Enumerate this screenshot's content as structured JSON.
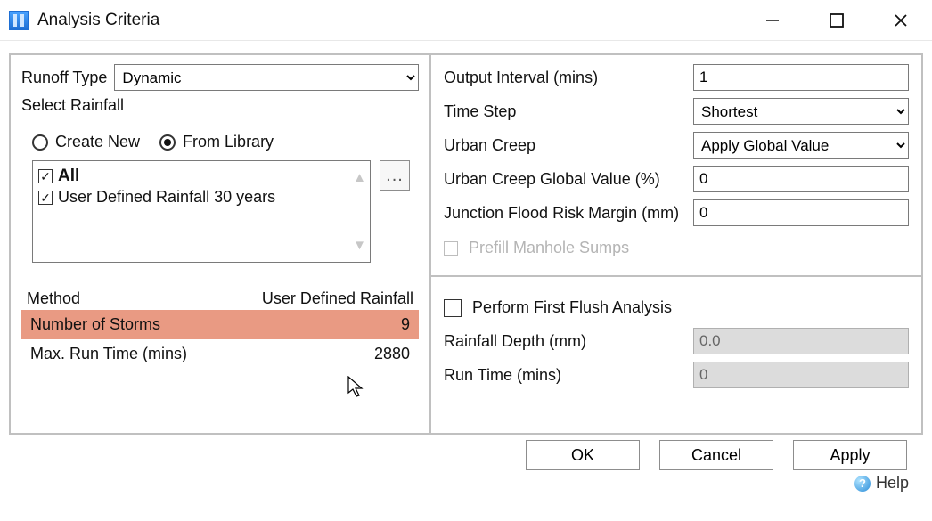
{
  "window": {
    "title": "Analysis Criteria"
  },
  "left": {
    "runoff_type_label": "Runoff Type",
    "runoff_type_value": "Dynamic",
    "select_rainfall_label": "Select Rainfall",
    "rainfall_source": {
      "create_new_label": "Create New",
      "from_library_label": "From Library",
      "selected": "from_library"
    },
    "library_items": [
      {
        "label": "All",
        "checked": true,
        "bold": true
      },
      {
        "label": "User Defined Rainfall 30 years",
        "checked": true,
        "bold": false
      }
    ],
    "browse_label": "...",
    "table": {
      "header_method": "Method",
      "header_value": "User Defined Rainfall",
      "rows": [
        {
          "name": "Number of Storms",
          "value": "9",
          "highlight": true
        },
        {
          "name": "Max. Run Time (mins)",
          "value": "2880",
          "highlight": false
        }
      ]
    }
  },
  "right": {
    "output_interval_label": "Output Interval (mins)",
    "output_interval_value": "1",
    "time_step_label": "Time Step",
    "time_step_value": "Shortest",
    "urban_creep_label": "Urban Creep",
    "urban_creep_value": "Apply Global Value",
    "urban_creep_global_label": "Urban Creep Global Value (%)",
    "urban_creep_global_value": "0",
    "junction_margin_label": "Junction Flood Risk Margin (mm)",
    "junction_margin_value": "0",
    "prefill_label": "Prefill Manhole Sumps",
    "first_flush_label": "Perform First Flush Analysis",
    "rainfall_depth_label": "Rainfall Depth (mm)",
    "rainfall_depth_value": "0.0",
    "run_time_label": "Run Time (mins)",
    "run_time_value": "0"
  },
  "footer": {
    "ok": "OK",
    "cancel": "Cancel",
    "apply": "Apply",
    "help": "Help"
  }
}
